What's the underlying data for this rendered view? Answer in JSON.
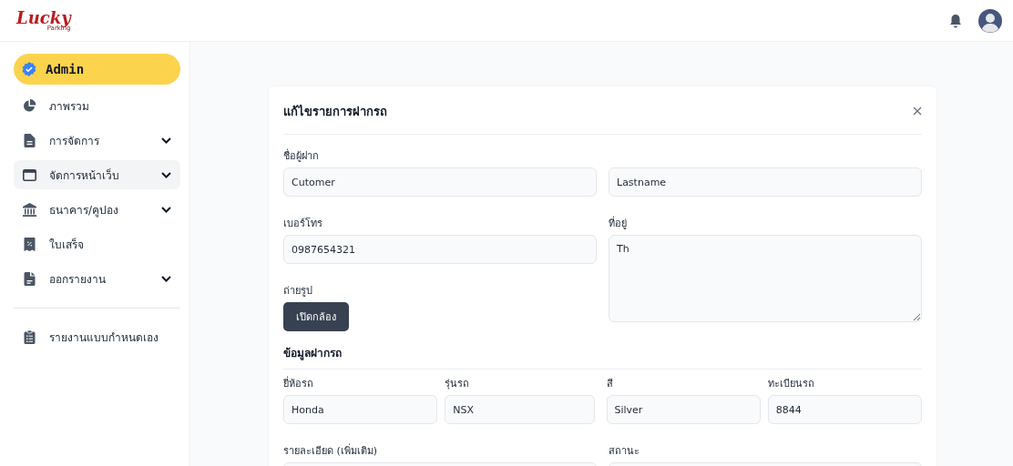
{
  "header": {
    "logo": {
      "title": "Lucky",
      "subtitle": "Parking"
    }
  },
  "sidebar": {
    "profile": {
      "label": "Admin"
    },
    "items": [
      {
        "label": "ภาพรวม",
        "has_submenu": false,
        "selected": false
      },
      {
        "label": "การจัดการ",
        "has_submenu": true,
        "selected": false
      },
      {
        "label": "จัดการหน้าเว็บ",
        "has_submenu": true,
        "selected": true
      },
      {
        "label": "ธนาคาร/คูปอง",
        "has_submenu": true,
        "selected": false
      },
      {
        "label": "ใบเสร็จ",
        "has_submenu": false,
        "selected": false
      },
      {
        "label": "ออกรายงาน",
        "has_submenu": true,
        "selected": false
      }
    ],
    "footer_items": [
      {
        "label": "รายงานแบบกำหนดเอง",
        "has_submenu": false,
        "selected": false
      }
    ]
  },
  "dialog": {
    "title": "แก้ไขรายการฝากรถ",
    "customer": {
      "name_label": "ชื่อผู้ฝาก",
      "first_name": "Cutomer",
      "last_name": "Lastname",
      "phone_label": "เบอร์โทร",
      "phone": "0987654321",
      "address_label": "ที่อยู่",
      "address": "Th",
      "photo_label": "ถ่ายรูป",
      "camera_button": "เปิดกล้อง"
    },
    "vehicle": {
      "heading": "ข้อมูลฝากรถ",
      "fields": [
        {
          "label": "ยี่ห้อรถ",
          "value": "Honda"
        },
        {
          "label": "รุ่นรถ",
          "value": "NSX"
        },
        {
          "label": "สี",
          "value": "Silver"
        },
        {
          "label": "ทะเบียนรถ",
          "value": "8844"
        }
      ],
      "details_label": "รายละเอียด (เพิ่มเติม)",
      "status_label": "สถานะ"
    }
  }
}
